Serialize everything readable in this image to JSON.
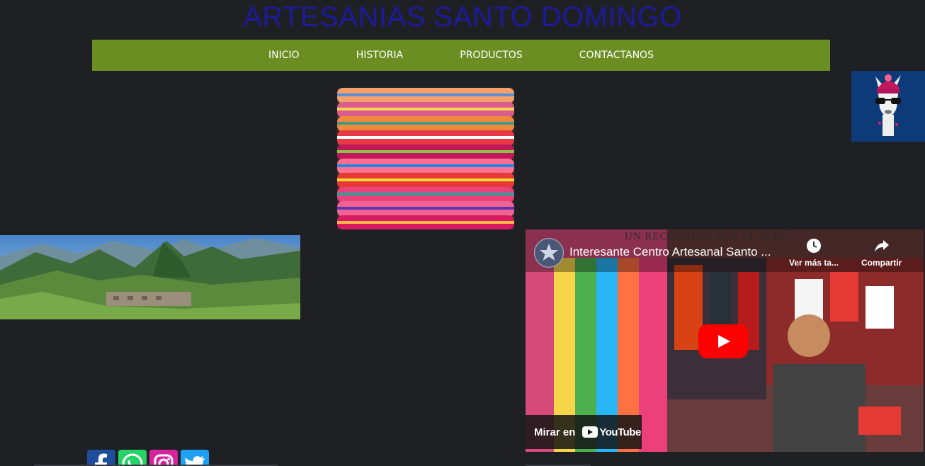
{
  "site": {
    "title": "ARTESANIAS SANTO DOMINGO"
  },
  "nav": {
    "items": [
      {
        "label": "INICIO"
      },
      {
        "label": "HISTORIA"
      },
      {
        "label": "PRODUCTOS"
      },
      {
        "label": "CONTACTANOS"
      }
    ]
  },
  "video": {
    "title": "Interesante Centro Artesanal Santo ...",
    "banner": "UN RECORRIDO POR EL PERÚ",
    "watch_later": "Ver más ta...",
    "share": "Compartir",
    "watch_on": "Mirar en",
    "platform": "YouTube"
  },
  "social": {
    "icons": [
      "facebook-icon",
      "whatsapp-icon",
      "instagram-icon",
      "twitter-icon"
    ]
  },
  "colors": {
    "background": "#1f2024",
    "title": "#1d1a9c",
    "navbar": "#6b8e23",
    "play_button": "#ff0000"
  }
}
